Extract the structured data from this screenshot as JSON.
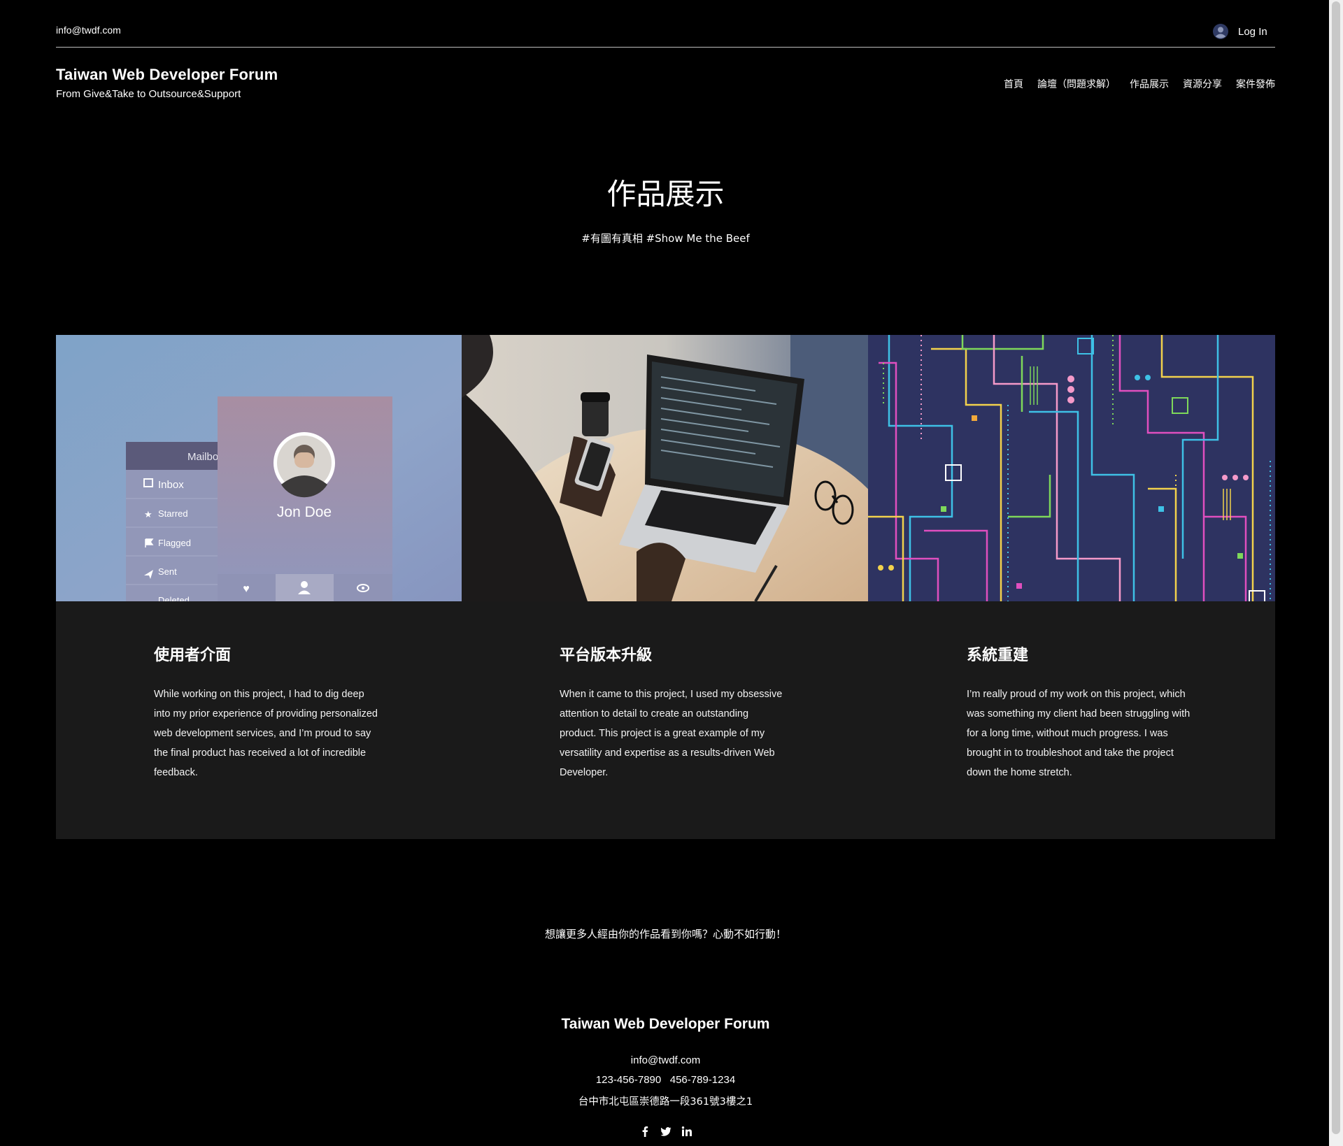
{
  "topbar": {
    "email": "info@twdf.com",
    "login_label": "Log In"
  },
  "header": {
    "title": "Taiwan Web Developer Forum",
    "tagline": "From Give&Take to Outsource&Support",
    "nav": [
      {
        "label": "首頁"
      },
      {
        "label": "論壇（問題求解）"
      },
      {
        "label": "作品展示"
      },
      {
        "label": "資源分享"
      },
      {
        "label": "案件發佈"
      }
    ]
  },
  "hero": {
    "title": "作品展示",
    "subtitle": "#有圖有真相 #Show Me the Beef"
  },
  "image1": {
    "mailbox_label": "Mailbo",
    "menu": [
      "Inbox",
      "Starred",
      "Flagged",
      "Sent",
      "Deleted"
    ],
    "profile_name": "Jon Doe"
  },
  "cards": [
    {
      "title": "使用者介面",
      "description": "While working on this project, I had to dig deep into my prior experience of providing personalized web development services, and I’m proud to say the final product has received a lot of incredible feedback."
    },
    {
      "title": "平台版本升級",
      "description": "When it came to this project, I used my obsessive attention to detail to create an outstanding product. This project is a great example of my versatility and expertise as a results-driven Web Developer."
    },
    {
      "title": "系統重建",
      "description": "I’m really proud of my work on this project, which was something my client had been struggling with for a long time, without much progress. I was brought in to troubleshoot and take the project down the home stretch."
    }
  ],
  "cta": "想讓更多人經由你的作品看到你嗎？心動不如行動！",
  "footer": {
    "title": "Taiwan Web Developer Forum",
    "email": "info@twdf.com",
    "phones": "123-456-7890   456-789-1234",
    "address": "台中市北屯區崇德路一段361號3樓之1",
    "social": [
      "facebook-icon",
      "twitter-icon",
      "linkedin-icon"
    ]
  },
  "colors": {
    "background": "#000000",
    "card_panel": "#1a1a1a",
    "text": "#ffffff",
    "circuit_bg": "#2e3361"
  }
}
